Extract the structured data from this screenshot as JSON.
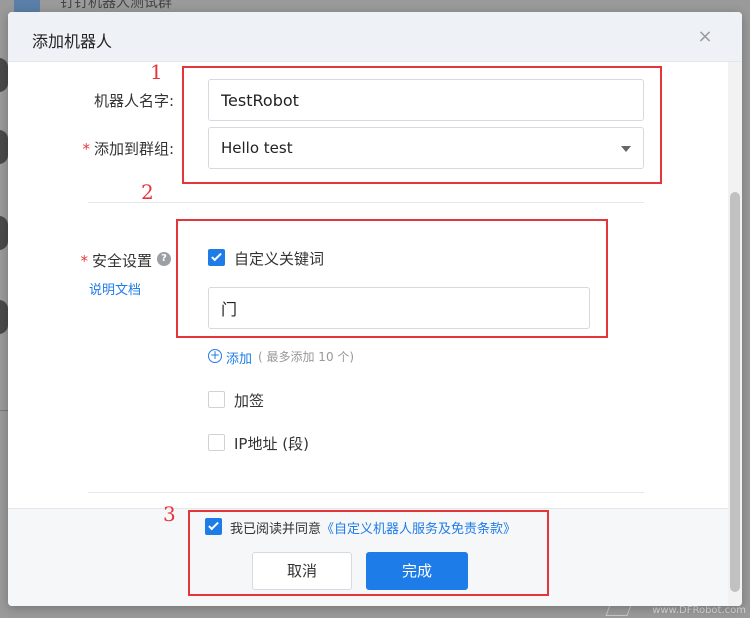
{
  "background": {
    "chat_title": "钉钉机器人测试群",
    "watermark": "www.DFRobot.com"
  },
  "dialog": {
    "title": "添加机器人",
    "close_glyph": "×"
  },
  "form": {
    "robot_name": {
      "label": "机器人名字:",
      "value": "TestRobot"
    },
    "group": {
      "required_mark": "*",
      "label": "添加到群组:",
      "selected": "Hello test"
    },
    "security": {
      "required_mark": "*",
      "label": "安全设置",
      "help_glyph": "?",
      "doc_link": "说明文档",
      "keyword_option": {
        "label": "自定义关键词",
        "checked": true
      },
      "keyword_value": "门",
      "add_link": "添加",
      "add_hint": "( 最多添加 10 个)",
      "sign_option": {
        "label": "加签",
        "checked": false
      },
      "ip_option": {
        "label": "IP地址 (段)",
        "checked": false
      }
    }
  },
  "footer": {
    "agree_text": "我已阅读并同意",
    "agree_link": "《自定义机器人服务及免责条款》",
    "agree_checked": true,
    "cancel_label": "取消",
    "ok_label": "完成"
  },
  "annotations": [
    "1",
    "2",
    "3"
  ],
  "colors": {
    "accent": "#1e7ce8",
    "annotation": "#e5353a",
    "required": "#e4393c"
  },
  "icons": {
    "close": "close-icon",
    "caret": "chevron-down-icon",
    "help": "question-circle-icon",
    "add": "plus-circle-icon",
    "check": "checkmark-icon"
  }
}
